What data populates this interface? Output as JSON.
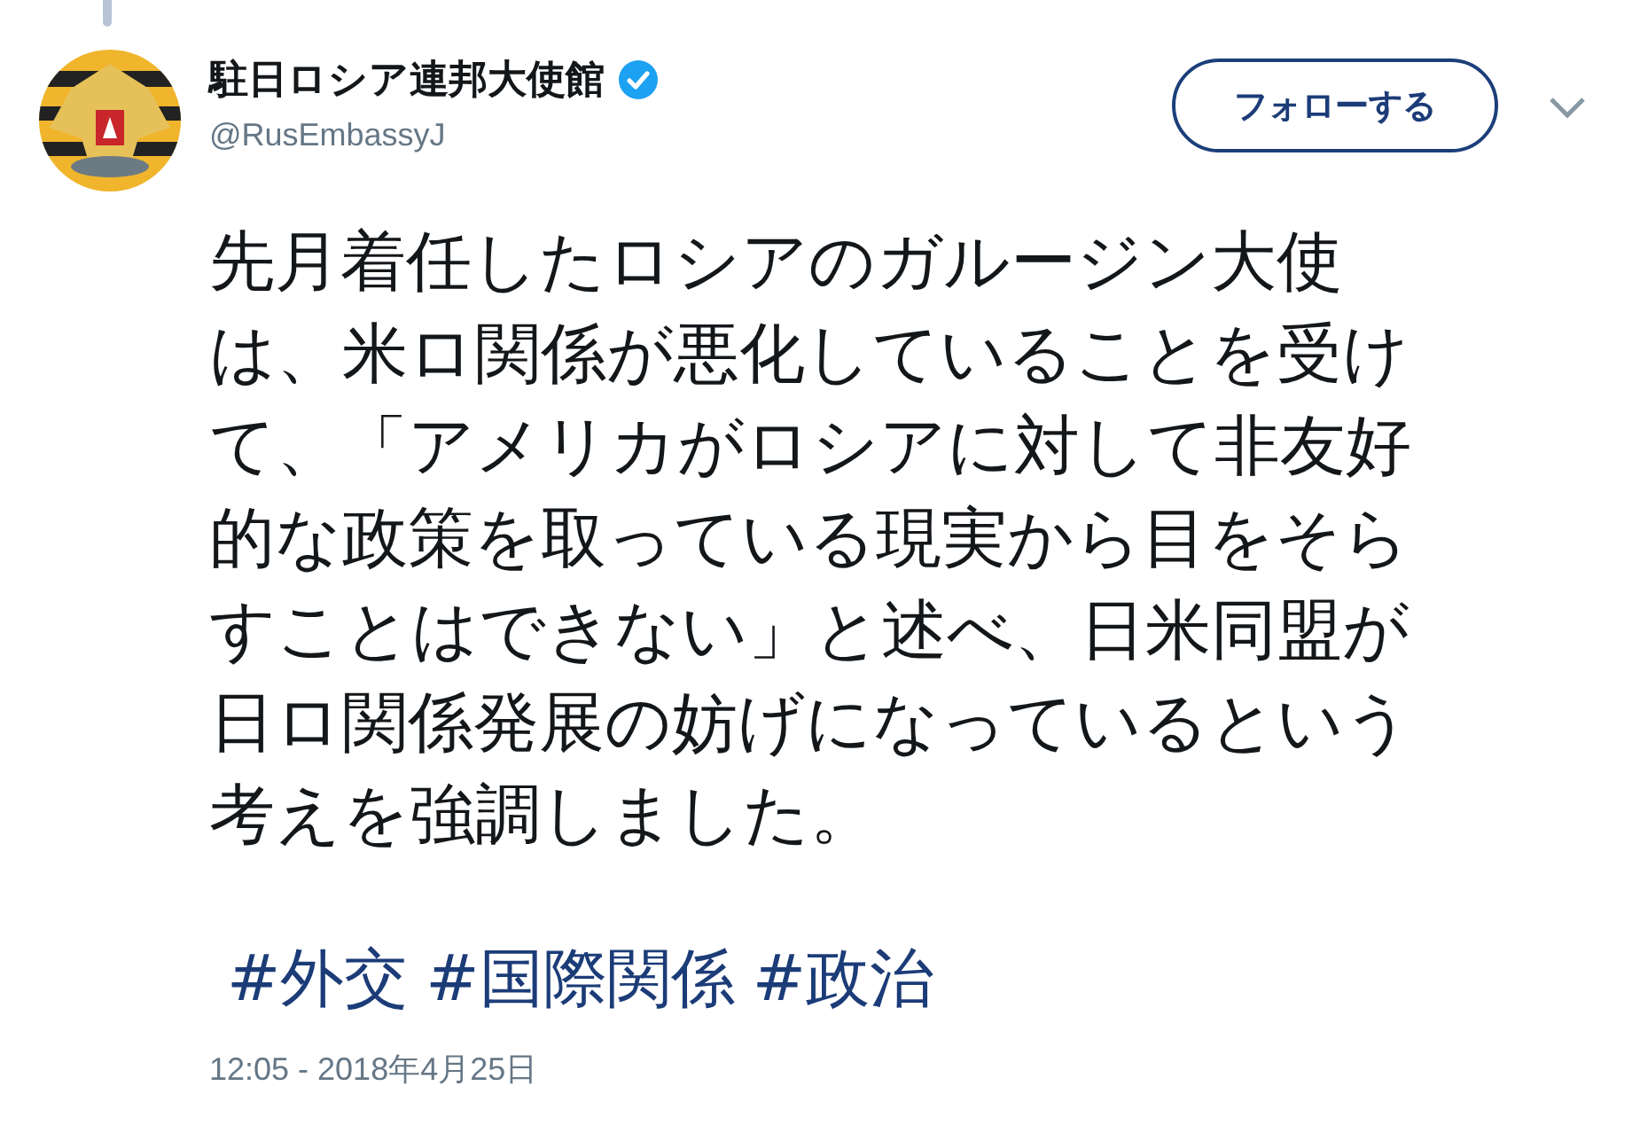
{
  "author": {
    "name": "駐日ロシア連邦大使館",
    "verified": true,
    "handle": "@RusEmbassyJ"
  },
  "follow_button": {
    "label": "フォローする"
  },
  "tweet": {
    "lines": [
      "先月着任したロシアのガルージン大使",
      "は、米ロ関係が悪化していることを受け",
      "て、「アメリカがロシアに対して非友好",
      "的な政策を取っている現実から目をそら",
      "すことはできない」と述べ、日米同盟が",
      "日ロ関係発展の妨げになっているという",
      "考えを強調しました。"
    ],
    "hashtags": [
      "#外交",
      "#国際関係",
      "#政治"
    ],
    "timestamp": "12:05 - 2018年4月25日"
  }
}
